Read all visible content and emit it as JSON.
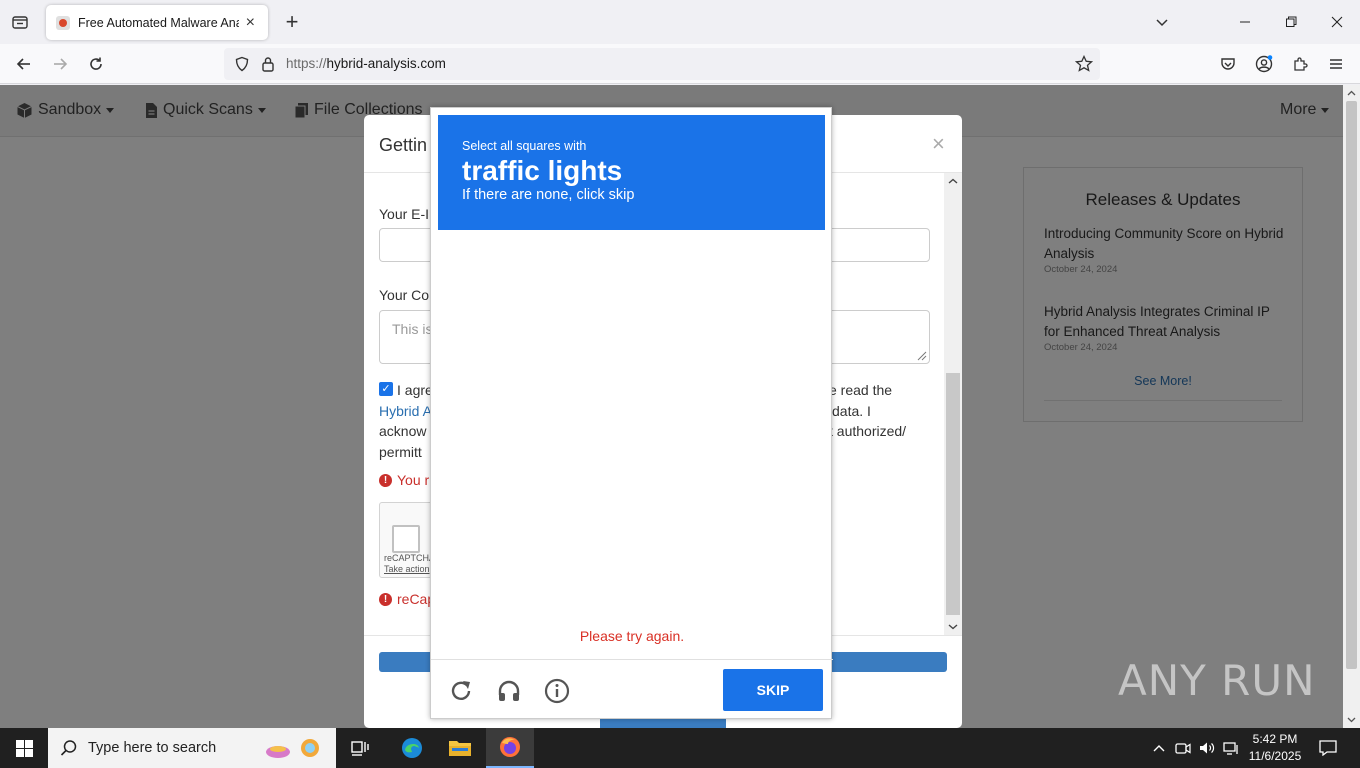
{
  "browser": {
    "tab": {
      "title": "Free Automated Malware Analy"
    },
    "url": {
      "scheme": "https://",
      "host": "hybrid-analysis.com"
    }
  },
  "site_nav": {
    "items": [
      {
        "label": "Sandbox"
      },
      {
        "label": "Quick Scans"
      },
      {
        "label": "File Collections"
      }
    ],
    "more": "More"
  },
  "releases": {
    "title": "Releases & Updates",
    "items": [
      {
        "title": "Introducing Community Score on Hybrid Analysis",
        "date": "October 24, 2024"
      },
      {
        "title": "Hybrid Analysis Integrates Criminal IP for Enhanced Threat Analysis",
        "date": "October 24, 2024"
      }
    ],
    "see_more": "See More!"
  },
  "modal": {
    "title": "Gettin",
    "email_label": "Your E-I",
    "comment_label": "Your Co",
    "comment_placeholder": "This is",
    "terms_left": [
      "I agre",
      "Hybrid A",
      "acknow",
      "permitt"
    ],
    "terms_right": [
      "ve read the",
      "data. I",
      "t authorized/"
    ],
    "error_required": "You r",
    "error_recaptcha": "reCap",
    "recaptcha_brand": "reCAPTCHA",
    "recaptcha_action": "Take action"
  },
  "captcha": {
    "instruction": "Select all squares with",
    "target": "traffic lights",
    "hint": "If there are none, click skip",
    "error": "Please try again.",
    "skip_label": "SKIP",
    "grid": {
      "rows": 4,
      "cols": 4
    }
  },
  "watermark": "ANY RUN",
  "taskbar": {
    "search_placeholder": "Type here to search",
    "time": "5:42 PM",
    "date": "11/6/2025"
  }
}
